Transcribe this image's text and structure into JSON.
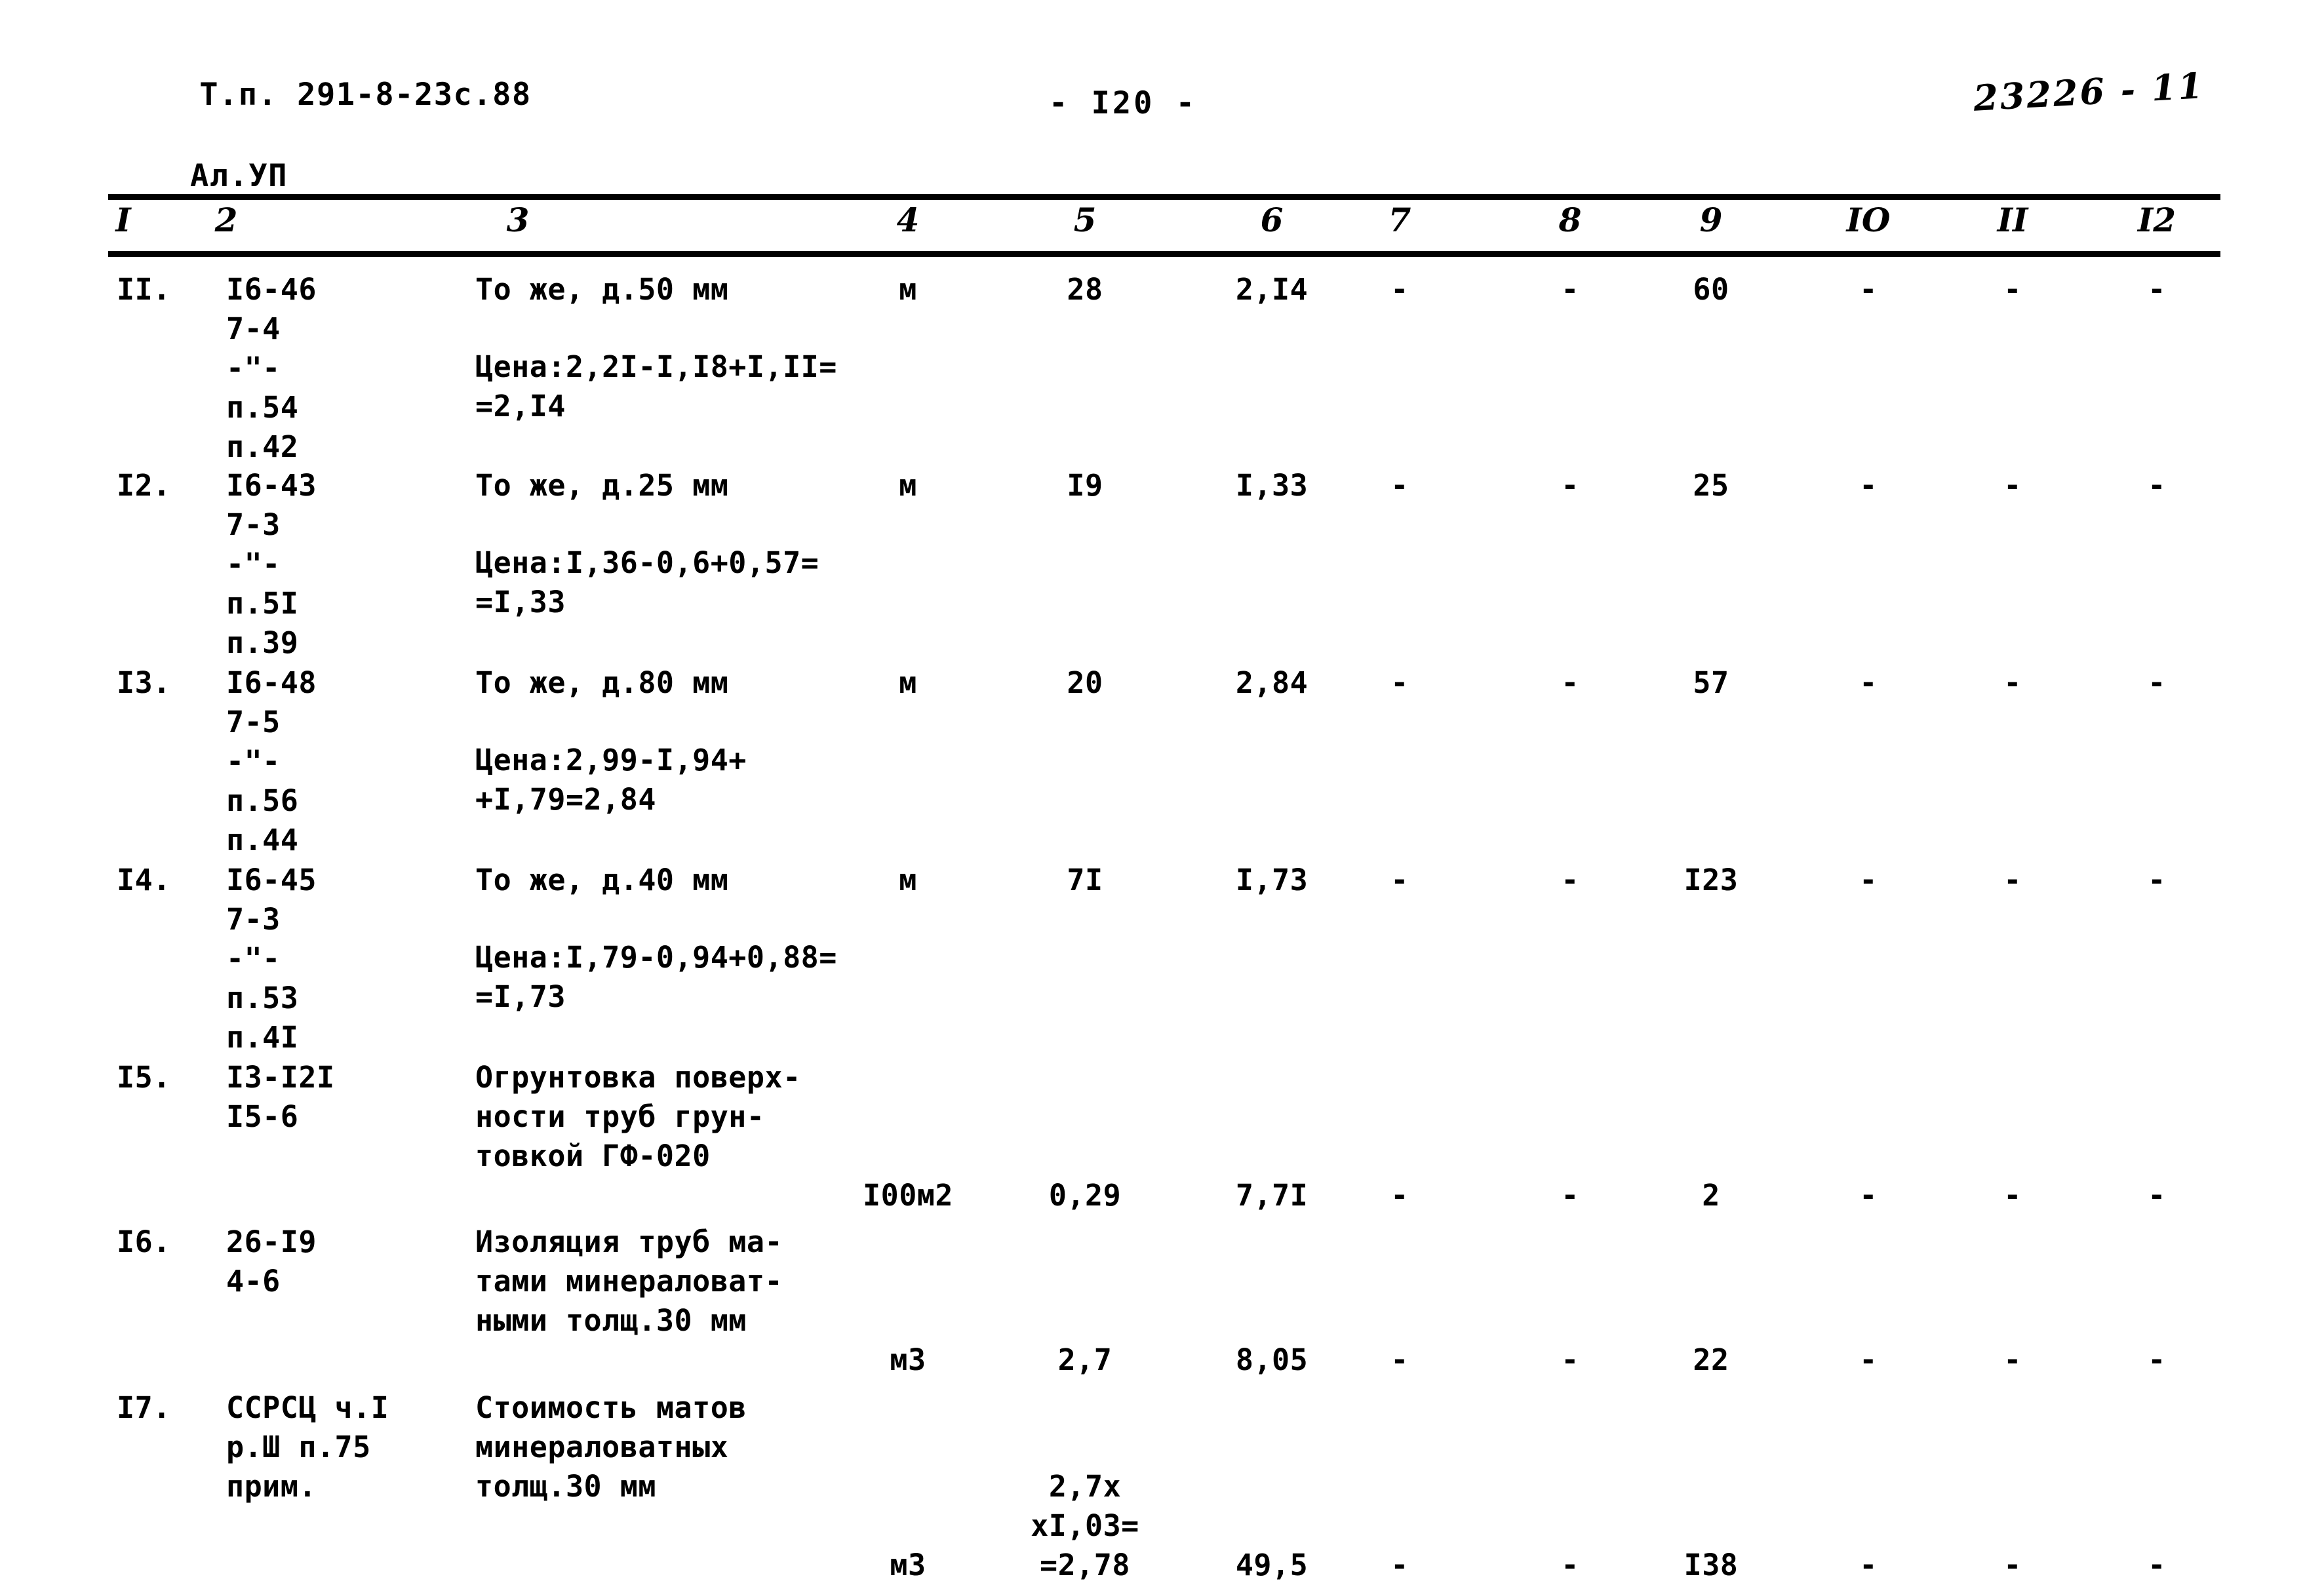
{
  "header": {
    "doc_code_line1": "Т.п. 291-8-23с.88",
    "doc_code_line2": "Ал.УП",
    "page_number": "- I20 -",
    "handwritten_note": "23226 - 11"
  },
  "table": {
    "column_headers": [
      "I",
      "2",
      "3",
      "4",
      "5",
      "6",
      "7",
      "8",
      "9",
      "IO",
      "II",
      "I2"
    ],
    "rows": [
      {
        "num": "II.",
        "code": "I6-46\n7-4\n-\"-\nп.54\nп.42",
        "desc": "То же, д.50 мм",
        "price_calc": "Цена:2,2I-I,I8+I,II=\n=2,I4",
        "unit": "м",
        "qty": "28",
        "c6": "2,I4",
        "c7": "-",
        "c8": "-",
        "c9": "60",
        "c10": "-",
        "c11": "-",
        "c12": "-"
      },
      {
        "num": "I2.",
        "code": "I6-43\n7-3\n-\"-\nп.5I\nп.39",
        "desc": "То же, д.25 мм",
        "price_calc": "Цена:I,36-0,6+0,57=\n=I,33",
        "unit": "м",
        "qty": "I9",
        "c6": "I,33",
        "c7": "-",
        "c8": "-",
        "c9": "25",
        "c10": "-",
        "c11": "-",
        "c12": "-"
      },
      {
        "num": "I3.",
        "code": "I6-48\n7-5\n-\"-\nп.56\nп.44",
        "desc": "То же, д.80 мм",
        "price_calc": "Цена:2,99-I,94+\n+I,79=2,84",
        "unit": "м",
        "qty": "20",
        "c6": "2,84",
        "c7": "-",
        "c8": "-",
        "c9": "57",
        "c10": "-",
        "c11": "-",
        "c12": "-"
      },
      {
        "num": "I4.",
        "code": "I6-45\n7-3\n-\"-\nп.53\nп.4I",
        "desc": "То же, д.40 мм",
        "price_calc": "Цена:I,79-0,94+0,88=\n=I,73",
        "unit": "м",
        "qty": "7I",
        "c6": "I,73",
        "c7": "-",
        "c8": "-",
        "c9": "I23",
        "c10": "-",
        "c11": "-",
        "c12": "-"
      },
      {
        "num": "I5.",
        "code": "I3-I2I\nI5-6",
        "desc": "Огрунтовка поверх-\nности труб грун-\nтовкой ГФ-020",
        "price_calc": "",
        "unit": "I00м2",
        "qty": "0,29",
        "c6": "7,7I",
        "c7": "-",
        "c8": "-",
        "c9": "2",
        "c10": "-",
        "c11": "-",
        "c12": "-"
      },
      {
        "num": "I6.",
        "code": "26-I9\n4-6",
        "desc": "Изоляция труб ма-\nтами минераловат-\nными толщ.30 мм",
        "price_calc": "",
        "unit": "м3",
        "qty": "2,7",
        "c6": "8,05",
        "c7": "-",
        "c8": "-",
        "c9": "22",
        "c10": "-",
        "c11": "-",
        "c12": "-"
      },
      {
        "num": "I7.",
        "code": "ССРСЦ ч.I\nр.Ш п.75\nприм.",
        "desc": "Стоимость матов\nминераловатных\nтолщ.30 мм",
        "price_calc": "",
        "unit": "м3",
        "qty": "2,7х\nхI,03=\n=2,78",
        "c6": "49,5",
        "c7": "-",
        "c8": "-",
        "c9": "I38",
        "c10": "-",
        "c11": "-",
        "c12": "-"
      }
    ]
  }
}
